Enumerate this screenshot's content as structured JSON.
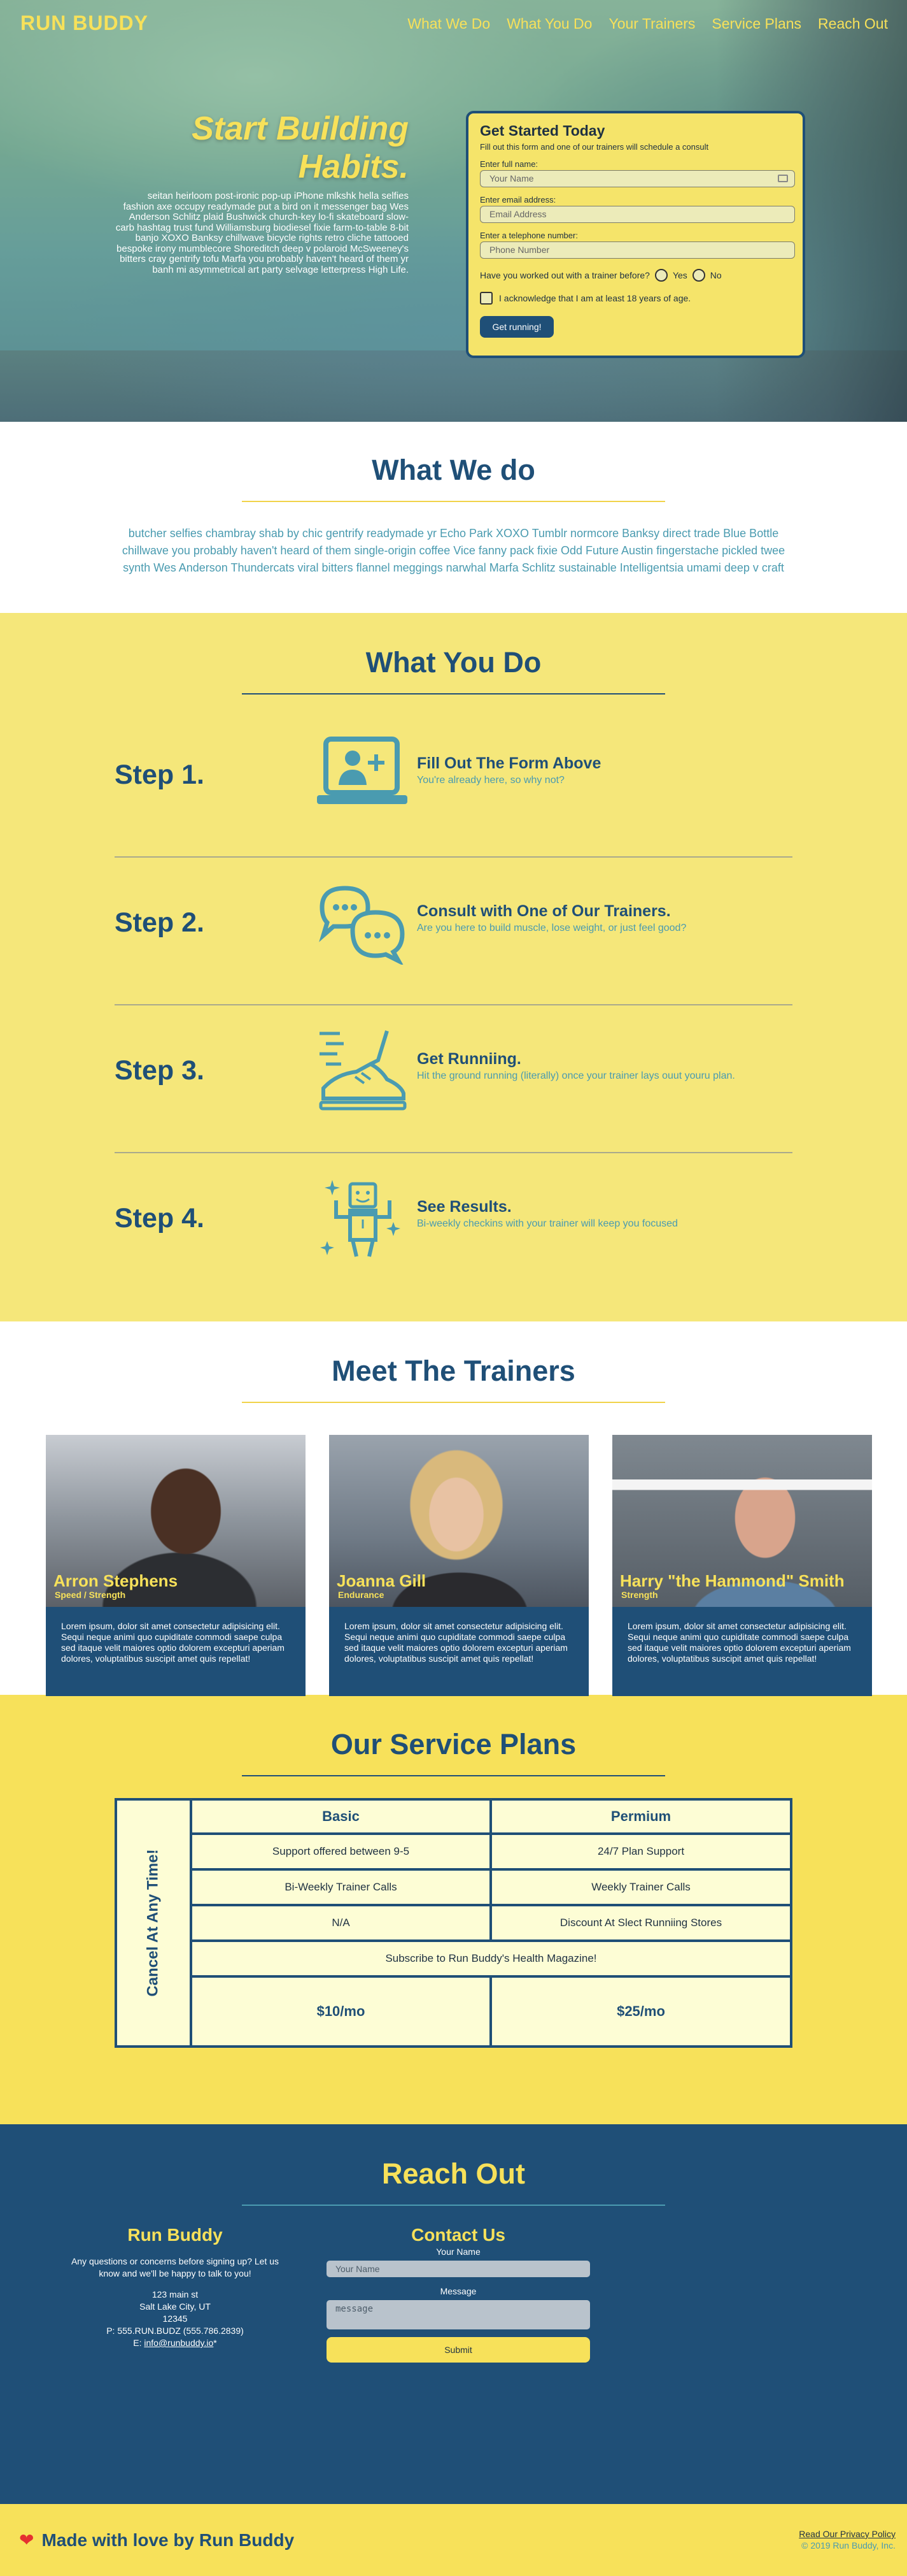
{
  "nav": {
    "brand": "RUN BUDDY",
    "links": [
      "What We Do",
      "What You Do",
      "Your Trainers",
      "Service Plans",
      "Reach Out"
    ]
  },
  "hero": {
    "title_line1": "Start Building",
    "title_line2": "Habits.",
    "text": "seitan heirloom post-ironic pop-up iPhone mlkshk hella selfies fashion axe occupy readymade put a bird on it messenger bag Wes Anderson Schlitz plaid Bushwick church-key lo-fi skateboard slow-carb hashtag trust fund Williamsburg biodiesel fixie farm-to-table 8-bit banjo XOXO Banksy chillwave bicycle rights retro cliche tattooed bespoke irony mumblecore Shoreditch deep v polaroid McSweeney's bitters cray gentrify tofu Marfa you probably haven't heard of them yr banh mi asymmetrical art party selvage letterpress High Life."
  },
  "signup": {
    "title": "Get Started Today",
    "subtitle": "Fill out this form and one of our trainers will schedule a consult",
    "name_label": "Enter full name:",
    "name_placeholder": "Your Name",
    "email_label": "Enter email address:",
    "email_placeholder": "Email Address",
    "phone_label": "Enter a telephone number:",
    "phone_placeholder": "Phone Number",
    "worked_out_question": "Have you worked out with a trainer before?",
    "yes_label": "Yes",
    "no_label": "No",
    "age_ack": "I acknowledge that I am at least 18 years of age.",
    "button": "Get running!"
  },
  "what_we_do": {
    "title": "What We do",
    "text": "butcher selfies chambray shab by chic gentrify readymade yr Echo Park XOXO Tumblr normcore Banksy direct trade Blue Bottle chillwave you probably haven't heard of them single-origin coffee Vice fanny pack fixie Odd Future Austin fingerstache pickled twee synth Wes Anderson Thundercats viral bitters flannel meggings narwhal Marfa Schlitz sustainable Intelligentsia umami deep v craft"
  },
  "what_you_do": {
    "title": "What You Do",
    "steps": [
      {
        "label": "Step 1.",
        "heading": "Fill Out The Form Above",
        "desc": "You're already here, so why not?",
        "icon": "laptop-add-user-icon"
      },
      {
        "label": "Step 2.",
        "heading": "Consult with One of Our Trainers.",
        "desc": "Are you here to build muscle, lose weight, or just feel good?",
        "icon": "chat-bubbles-icon"
      },
      {
        "label": "Step 3.",
        "heading": "Get Runniing.",
        "desc": "Hit the ground running (literally) once your trainer lays ouut youru plan.",
        "icon": "running-shoe-icon"
      },
      {
        "label": "Step 4.",
        "heading": "See Results.",
        "desc": "Bi-weekly checkins with your trainer will keep you focused",
        "icon": "strong-person-icon"
      }
    ]
  },
  "trainers": {
    "title": "Meet The Trainers",
    "cards": [
      {
        "name": "Arron Stephens",
        "specialty": "Speed / Strength",
        "bio": "Lorem ipsum, dolor sit amet consectetur adipisicing elit. Sequi neque animi quo cupiditate commodi saepe culpa sed itaque velit maiores optio dolorem excepturi aperiam dolores, voluptatibus suscipit amet quis repellat!"
      },
      {
        "name": "Joanna Gill",
        "specialty": "Endurance",
        "bio": "Lorem ipsum, dolor sit amet consectetur adipisicing elit. Sequi neque animi quo cupiditate commodi saepe culpa sed itaque velit maiores optio dolorem excepturi aperiam dolores, voluptatibus suscipit amet quis repellat!"
      },
      {
        "name": "Harry \"the Hammond\" Smith",
        "specialty": "Strength",
        "bio": "Lorem ipsum, dolor sit amet consectetur adipisicing elit. Sequi neque animi quo cupiditate commodi saepe culpa sed itaque velit maiores optio dolorem excepturi aperiam dolores, voluptatibus suscipit amet quis repellat!"
      }
    ]
  },
  "plans": {
    "title": "Our Service Plans",
    "side_label": "Cancel At Any Time!",
    "basic": "Basic",
    "premium": "Permium",
    "rows": [
      [
        "Support offered between 9-5",
        "24/7 Plan Support"
      ],
      [
        "Bi-Weekly Trainer Calls",
        "Weekly Trainer Calls"
      ],
      [
        "N/A",
        "Discount At Slect Runniing Stores"
      ]
    ],
    "magazine": "Subscribe to Run Buddy's Health Magazine!",
    "basic_price": "$10/mo",
    "premium_price": "$25/mo"
  },
  "reach_out": {
    "title": "Reach Out",
    "company": "Run Buddy",
    "intro": "Any questions or concerns before signing up? Let us know and we'll be happy to talk to you!",
    "street": "123 main st",
    "city": "Salt Lake City, UT",
    "zip": "12345",
    "phone": "P: 555.RUN.BUDZ (555.786.2839)",
    "email_prefix": "E: ",
    "email": "info@runbuddy.io",
    "email_suffix": "*",
    "contact_title": "Contact Us",
    "name_label": "Your Name",
    "name_placeholder": "Your Name",
    "message_label": "Message",
    "message_placeholder": "message",
    "submit": "Submit"
  },
  "footer": {
    "love": "Made with love by Run Buddy",
    "privacy": "Read Our Privacy Policy",
    "copyright": "© 2019 Run Buddy, Inc."
  }
}
